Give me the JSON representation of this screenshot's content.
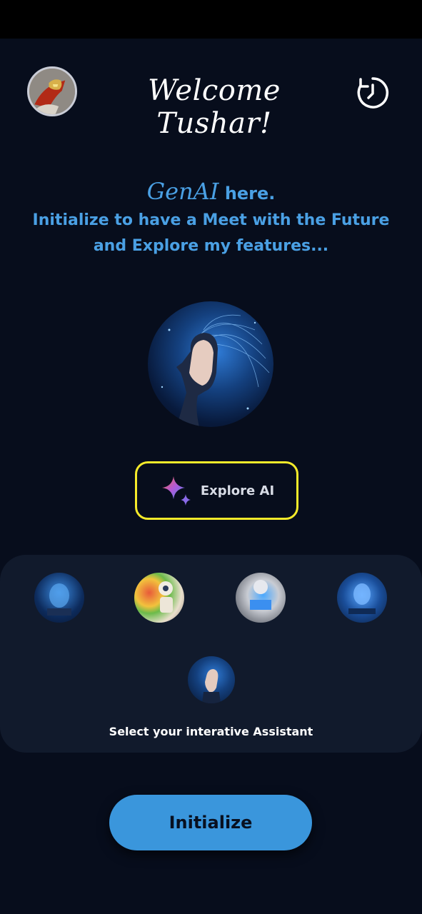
{
  "header": {
    "welcome_text": "Welcome Tushar!",
    "avatar_icon": "iron-man-avatar",
    "history_icon": "clock-history-icon"
  },
  "intro": {
    "genai": "GenAI",
    "here": "here.",
    "line2": "Initialize to have a Meet with the Future",
    "line3": "and Explore my features..."
  },
  "explore": {
    "label": "Explore AI",
    "icon": "sparkle-icon",
    "highlight_color": "#f5ea2a"
  },
  "assistants": {
    "caption": "Select your interative Assistant",
    "items": [
      "cyber-head-assistant",
      "painter-robot-assistant",
      "robot-laptop-assistant",
      "blue-robot-assistant",
      "ai-woman-assistant"
    ]
  },
  "footer": {
    "initialize_label": "Initialize"
  },
  "colors": {
    "background": "#070d1c",
    "accent": "#4aa0e4",
    "button": "#3a96dc"
  }
}
